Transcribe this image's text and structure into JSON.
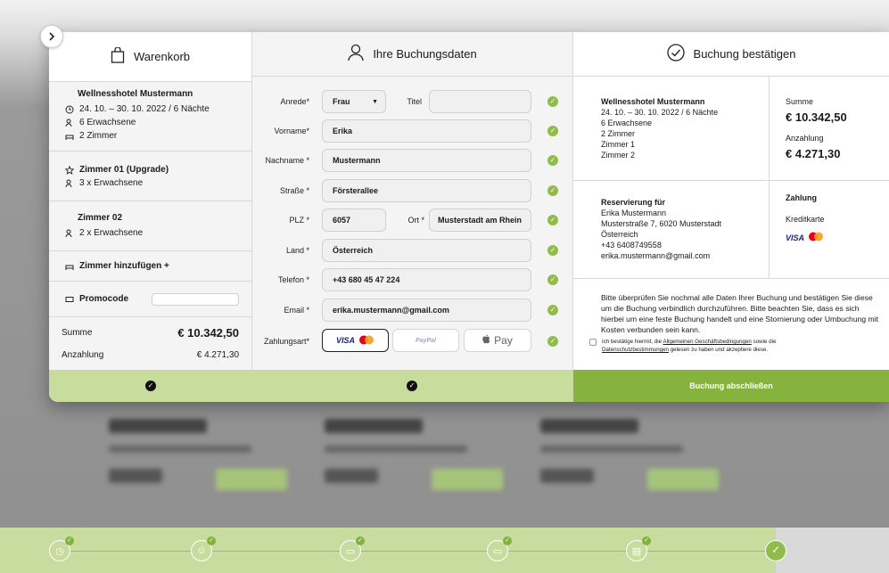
{
  "cart": {
    "title": "Warenkorb",
    "hotel": {
      "name": "Wellnesshotel Mustermann",
      "dates": "24. 10. – 30. 10. 2022 / 6 Nächte",
      "guests": "6  Erwachsene",
      "rooms": "2 Zimmer"
    },
    "room1": {
      "name": "Zimmer 01 (Upgrade)",
      "guests": "3 x Erwachsene"
    },
    "room2": {
      "name": "Zimmer 02",
      "guests": "2 x Erwachsene"
    },
    "add_room": "Zimmer hinzufügen +",
    "promo_label": "Promocode",
    "promo_value": "",
    "sum_label": "Summe",
    "sum_value": "€ 10.342,50",
    "deposit_label": "Anzahlung",
    "deposit_value": "€ 4.271,30"
  },
  "form": {
    "title": "Ihre Buchungsdaten",
    "anrede_label": "Anrede*",
    "anrede_value": "Frau",
    "titel_label": "Titel",
    "titel_value": "",
    "vorname_label": "Vorname*",
    "vorname_value": "Erika",
    "nachname_label": "Nachname *",
    "nachname_value": "Mustermann",
    "strasse_label": "Straße *",
    "strasse_value": "Försterallee",
    "plz_label": "PLZ *",
    "plz_value": "6057",
    "ort_label": "Ort *",
    "ort_value": "Musterstadt am Rhein",
    "land_label": "Land *",
    "land_value": "Österreich",
    "telefon_label": "Telefon *",
    "telefon_value": "+43 680 45 47 224",
    "email_label": "Email *",
    "email_value": "erika.mustermann@gmail.com",
    "payment_label": "Zahlungsart*",
    "payment_visa": "VISA",
    "payment_paypal": "PayPal",
    "payment_apple": "Pay"
  },
  "confirm": {
    "title": "Buchung bestätigen",
    "hotel_name": "Wellnesshotel Mustermann",
    "hotel_dates": "24. 10. – 30. 10. 2022 / 6 Nächte",
    "hotel_guests": "6 Erwachsene",
    "hotel_rooms": "2 Zimmer",
    "room1": "Zimmer 1",
    "room2": "Zimmer 2",
    "sum_label": "Summe",
    "sum_value": "€ 10.342,50",
    "deposit_label": "Anzahlung",
    "deposit_value": "€ 4.271,30",
    "reservation_label": "Reservierung für",
    "res_name": "Erika Mustermann",
    "res_address": "Musterstraße 7, 6020 Musterstadt",
    "res_country": "Österreich",
    "res_phone": "+43 6408749558",
    "res_email": "erika.mustermann@gmail.com",
    "payment_label": "Zahlung",
    "payment_method": "Kreditkarte",
    "payment_visa": "VISA",
    "notice": "Bitte überprüfen Sie nochmal alle Daten Ihrer Buchung und bestätigen Sie diese um die Buchung verbindlich durchzuführen. Bitte beachten Sie, dass es sich hierbei um eine feste Buchung handelt und eine Stornierung oder Umbuchung mit Kosten verbunden sein kann.",
    "terms_prefix": "Ich bestätige hiermit, die ",
    "terms_link1": "Allgemeinen Geschäftsbedingungen",
    "terms_mid": " sowie die ",
    "terms_link2": "Datenschutzbestimmungen",
    "terms_suffix": " gelesen zu haben und akzeptiere diese.",
    "submit": "Buchung abschließen"
  },
  "colors": {
    "accent": "#86b33e",
    "accent_light": "#c8dc9e",
    "ok": "#8fbc4a"
  }
}
